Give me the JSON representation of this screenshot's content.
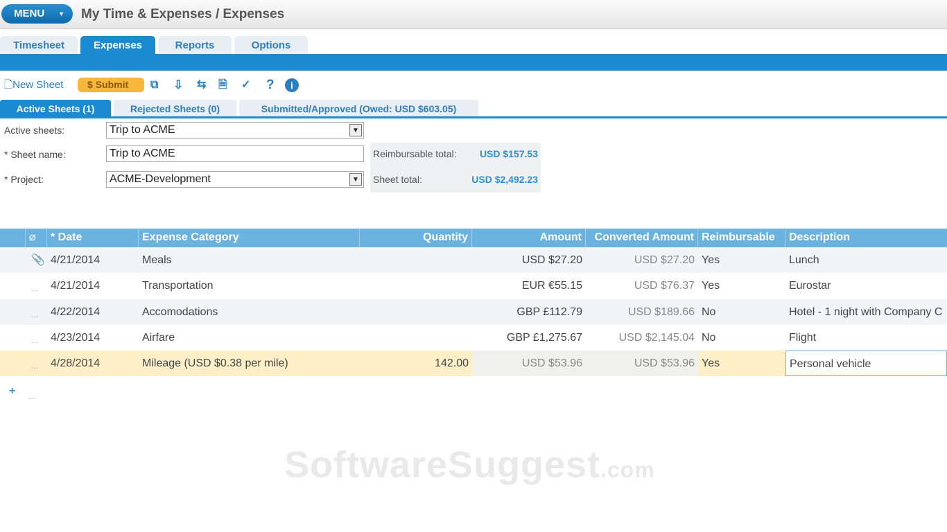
{
  "header": {
    "menu_label": "MENU",
    "title": "My Time & Expenses / Expenses"
  },
  "tabs": [
    "Timesheet",
    "Expenses",
    "Reports",
    "Options"
  ],
  "toolbar": {
    "new_sheet": "New Sheet",
    "submit": "Submit"
  },
  "subtabs": [
    "Active Sheets (1)",
    "Rejected Sheets (0)",
    "Submitted/Approved (Owed: USD $603.05)"
  ],
  "form": {
    "active_sheets_label": "Active sheets:",
    "active_sheets_value": "Trip to ACME",
    "sheet_name_label": "* Sheet name:",
    "sheet_name_value": "Trip to ACME",
    "project_label": "* Project:",
    "project_value": "ACME-Development",
    "reimbursable_total_label": "Reimbursable total:",
    "reimbursable_total": "USD $157.53",
    "sheet_total_label": "Sheet total:",
    "sheet_total": "USD $2,492.23"
  },
  "grid": {
    "columns": [
      "* Date",
      "Expense Category",
      "Quantity",
      "Amount",
      "Converted Amount",
      "Reimbursable",
      "Description"
    ],
    "rows": [
      {
        "date": "4/21/2014",
        "category": "Meals",
        "quantity": "",
        "amount": "USD $27.20",
        "converted": "USD $27.20",
        "reimbursable": "Yes",
        "description": "Lunch"
      },
      {
        "date": "4/21/2014",
        "category": "Transportation",
        "quantity": "",
        "amount": "EUR €55.15",
        "converted": "USD $76.37",
        "reimbursable": "Yes",
        "description": "Eurostar"
      },
      {
        "date": "4/22/2014",
        "category": "Accomodations",
        "quantity": "",
        "amount": "GBP £112.79",
        "converted": "USD $189.66",
        "reimbursable": "No",
        "description": "Hotel - 1 night with Company C"
      },
      {
        "date": "4/23/2014",
        "category": "Airfare",
        "quantity": "",
        "amount": "GBP £1,275.67",
        "converted": "USD $2,145.04",
        "reimbursable": "No",
        "description": "Flight"
      },
      {
        "date": "4/28/2014",
        "category": "Mileage (USD $0.38 per mile)",
        "quantity": "142.00",
        "amount": "USD $53.96",
        "converted": "USD $53.96",
        "reimbursable": "Yes",
        "description": "Personal vehicle"
      }
    ],
    "dots": "...",
    "add": "+"
  },
  "watermark": {
    "main": "SoftwareSuggest",
    "suffix": ".com"
  }
}
